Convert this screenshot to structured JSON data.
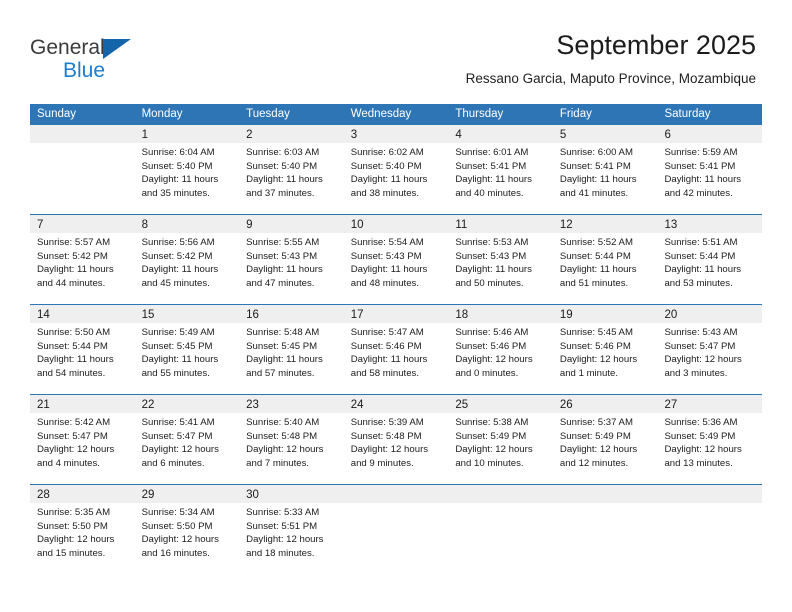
{
  "brand": {
    "line1": "General",
    "line2": "Blue",
    "triangle_color": "#1464aa",
    "blue_text_color": "#1a7fd4"
  },
  "header": {
    "title": "September 2025",
    "subtitle": "Ressano Garcia, Maputo Province, Mozambique"
  },
  "theme": {
    "header_blue": "#2e75b6",
    "day_band_gray": "#efefef",
    "text": "#1c1c1c"
  },
  "weekdays": [
    "Sunday",
    "Monday",
    "Tuesday",
    "Wednesday",
    "Thursday",
    "Friday",
    "Saturday"
  ],
  "weeks": [
    [
      {
        "day": "",
        "sunrise": "",
        "sunset": "",
        "daylight1": "",
        "daylight2": "",
        "empty": true
      },
      {
        "day": "1",
        "sunrise": "Sunrise: 6:04 AM",
        "sunset": "Sunset: 5:40 PM",
        "daylight1": "Daylight: 11 hours",
        "daylight2": "and 35 minutes."
      },
      {
        "day": "2",
        "sunrise": "Sunrise: 6:03 AM",
        "sunset": "Sunset: 5:40 PM",
        "daylight1": "Daylight: 11 hours",
        "daylight2": "and 37 minutes."
      },
      {
        "day": "3",
        "sunrise": "Sunrise: 6:02 AM",
        "sunset": "Sunset: 5:40 PM",
        "daylight1": "Daylight: 11 hours",
        "daylight2": "and 38 minutes."
      },
      {
        "day": "4",
        "sunrise": "Sunrise: 6:01 AM",
        "sunset": "Sunset: 5:41 PM",
        "daylight1": "Daylight: 11 hours",
        "daylight2": "and 40 minutes."
      },
      {
        "day": "5",
        "sunrise": "Sunrise: 6:00 AM",
        "sunset": "Sunset: 5:41 PM",
        "daylight1": "Daylight: 11 hours",
        "daylight2": "and 41 minutes."
      },
      {
        "day": "6",
        "sunrise": "Sunrise: 5:59 AM",
        "sunset": "Sunset: 5:41 PM",
        "daylight1": "Daylight: 11 hours",
        "daylight2": "and 42 minutes."
      }
    ],
    [
      {
        "day": "7",
        "sunrise": "Sunrise: 5:57 AM",
        "sunset": "Sunset: 5:42 PM",
        "daylight1": "Daylight: 11 hours",
        "daylight2": "and 44 minutes."
      },
      {
        "day": "8",
        "sunrise": "Sunrise: 5:56 AM",
        "sunset": "Sunset: 5:42 PM",
        "daylight1": "Daylight: 11 hours",
        "daylight2": "and 45 minutes."
      },
      {
        "day": "9",
        "sunrise": "Sunrise: 5:55 AM",
        "sunset": "Sunset: 5:43 PM",
        "daylight1": "Daylight: 11 hours",
        "daylight2": "and 47 minutes."
      },
      {
        "day": "10",
        "sunrise": "Sunrise: 5:54 AM",
        "sunset": "Sunset: 5:43 PM",
        "daylight1": "Daylight: 11 hours",
        "daylight2": "and 48 minutes."
      },
      {
        "day": "11",
        "sunrise": "Sunrise: 5:53 AM",
        "sunset": "Sunset: 5:43 PM",
        "daylight1": "Daylight: 11 hours",
        "daylight2": "and 50 minutes."
      },
      {
        "day": "12",
        "sunrise": "Sunrise: 5:52 AM",
        "sunset": "Sunset: 5:44 PM",
        "daylight1": "Daylight: 11 hours",
        "daylight2": "and 51 minutes."
      },
      {
        "day": "13",
        "sunrise": "Sunrise: 5:51 AM",
        "sunset": "Sunset: 5:44 PM",
        "daylight1": "Daylight: 11 hours",
        "daylight2": "and 53 minutes."
      }
    ],
    [
      {
        "day": "14",
        "sunrise": "Sunrise: 5:50 AM",
        "sunset": "Sunset: 5:44 PM",
        "daylight1": "Daylight: 11 hours",
        "daylight2": "and 54 minutes."
      },
      {
        "day": "15",
        "sunrise": "Sunrise: 5:49 AM",
        "sunset": "Sunset: 5:45 PM",
        "daylight1": "Daylight: 11 hours",
        "daylight2": "and 55 minutes."
      },
      {
        "day": "16",
        "sunrise": "Sunrise: 5:48 AM",
        "sunset": "Sunset: 5:45 PM",
        "daylight1": "Daylight: 11 hours",
        "daylight2": "and 57 minutes."
      },
      {
        "day": "17",
        "sunrise": "Sunrise: 5:47 AM",
        "sunset": "Sunset: 5:46 PM",
        "daylight1": "Daylight: 11 hours",
        "daylight2": "and 58 minutes."
      },
      {
        "day": "18",
        "sunrise": "Sunrise: 5:46 AM",
        "sunset": "Sunset: 5:46 PM",
        "daylight1": "Daylight: 12 hours",
        "daylight2": "and 0 minutes."
      },
      {
        "day": "19",
        "sunrise": "Sunrise: 5:45 AM",
        "sunset": "Sunset: 5:46 PM",
        "daylight1": "Daylight: 12 hours",
        "daylight2": "and 1 minute."
      },
      {
        "day": "20",
        "sunrise": "Sunrise: 5:43 AM",
        "sunset": "Sunset: 5:47 PM",
        "daylight1": "Daylight: 12 hours",
        "daylight2": "and 3 minutes."
      }
    ],
    [
      {
        "day": "21",
        "sunrise": "Sunrise: 5:42 AM",
        "sunset": "Sunset: 5:47 PM",
        "daylight1": "Daylight: 12 hours",
        "daylight2": "and 4 minutes."
      },
      {
        "day": "22",
        "sunrise": "Sunrise: 5:41 AM",
        "sunset": "Sunset: 5:47 PM",
        "daylight1": "Daylight: 12 hours",
        "daylight2": "and 6 minutes."
      },
      {
        "day": "23",
        "sunrise": "Sunrise: 5:40 AM",
        "sunset": "Sunset: 5:48 PM",
        "daylight1": "Daylight: 12 hours",
        "daylight2": "and 7 minutes."
      },
      {
        "day": "24",
        "sunrise": "Sunrise: 5:39 AM",
        "sunset": "Sunset: 5:48 PM",
        "daylight1": "Daylight: 12 hours",
        "daylight2": "and 9 minutes."
      },
      {
        "day": "25",
        "sunrise": "Sunrise: 5:38 AM",
        "sunset": "Sunset: 5:49 PM",
        "daylight1": "Daylight: 12 hours",
        "daylight2": "and 10 minutes."
      },
      {
        "day": "26",
        "sunrise": "Sunrise: 5:37 AM",
        "sunset": "Sunset: 5:49 PM",
        "daylight1": "Daylight: 12 hours",
        "daylight2": "and 12 minutes."
      },
      {
        "day": "27",
        "sunrise": "Sunrise: 5:36 AM",
        "sunset": "Sunset: 5:49 PM",
        "daylight1": "Daylight: 12 hours",
        "daylight2": "and 13 minutes."
      }
    ],
    [
      {
        "day": "28",
        "sunrise": "Sunrise: 5:35 AM",
        "sunset": "Sunset: 5:50 PM",
        "daylight1": "Daylight: 12 hours",
        "daylight2": "and 15 minutes."
      },
      {
        "day": "29",
        "sunrise": "Sunrise: 5:34 AM",
        "sunset": "Sunset: 5:50 PM",
        "daylight1": "Daylight: 12 hours",
        "daylight2": "and 16 minutes."
      },
      {
        "day": "30",
        "sunrise": "Sunrise: 5:33 AM",
        "sunset": "Sunset: 5:51 PM",
        "daylight1": "Daylight: 12 hours",
        "daylight2": "and 18 minutes."
      },
      {
        "day": "",
        "sunrise": "",
        "sunset": "",
        "daylight1": "",
        "daylight2": "",
        "empty": true
      },
      {
        "day": "",
        "sunrise": "",
        "sunset": "",
        "daylight1": "",
        "daylight2": "",
        "empty": true
      },
      {
        "day": "",
        "sunrise": "",
        "sunset": "",
        "daylight1": "",
        "daylight2": "",
        "empty": true
      },
      {
        "day": "",
        "sunrise": "",
        "sunset": "",
        "daylight1": "",
        "daylight2": "",
        "empty": true
      }
    ]
  ]
}
